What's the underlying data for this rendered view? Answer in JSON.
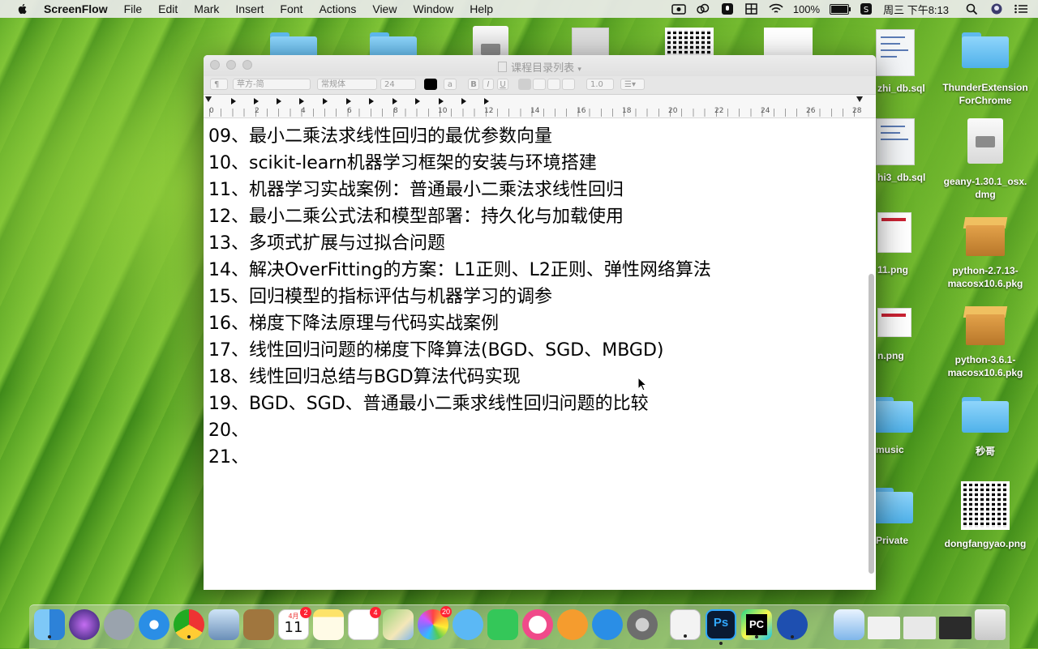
{
  "menubar": {
    "app_name": "ScreenFlow",
    "items": [
      "File",
      "Edit",
      "Mark",
      "Insert",
      "Font",
      "Actions",
      "View",
      "Window",
      "Help"
    ],
    "battery": "100%",
    "clock": "周三 下午8:13"
  },
  "desktop": {
    "icons": [
      {
        "label": "zhi_db.sql"
      },
      {
        "label": "ThunderExtension ForChrome"
      },
      {
        "label": "hi3_db.sql"
      },
      {
        "label": "geany-1.30.1_osx. dmg"
      },
      {
        "label": "11.png"
      },
      {
        "label": "python-2.7.13- macosx10.6.pkg"
      },
      {
        "label": "n.png"
      },
      {
        "label": "python-3.6.1- macosx10.6.pkg"
      },
      {
        "label": "music"
      },
      {
        "label": "秒哥"
      },
      {
        "label": "Private"
      },
      {
        "label": "dongfangyao.png"
      }
    ]
  },
  "window": {
    "title": "课程目录列表",
    "toolbar": {
      "paragraph": "¶",
      "font_family": "苹方-简",
      "font_style": "常规体",
      "font_size": "24",
      "bold": "B",
      "italic": "I",
      "underline": "U",
      "line_spacing": "1.0"
    },
    "ruler_numbers": [
      "0",
      "2",
      "4",
      "6",
      "8",
      "10",
      "12",
      "14",
      "16",
      "18",
      "20",
      "22",
      "24",
      "26",
      "28"
    ],
    "lines": [
      "09、最小二乘法求线性回归的最优参数向量",
      "10、scikit-learn机器学习框架的安装与环境搭建",
      "11、机器学习实战案例：普通最小二乘法求线性回归",
      "12、最小二乘公式法和模型部署：持久化与加载使用",
      "13、多项式扩展与过拟合问题",
      "14、解决OverFitting的方案：L1正则、L2正则、弹性网络算法",
      "15、回归模型的指标评估与机器学习的调参",
      "16、梯度下降法原理与代码实战案例",
      "17、线性回归问题的梯度下降算法(BGD、SGD、MBGD)",
      "18、线性回归总结与BGD算法代码实现",
      "19、BGD、SGD、普通最小二乘求线性回归问题的比较",
      "20、",
      "21、"
    ]
  },
  "dock": {
    "calendar_month": "4月",
    "calendar_day": "11",
    "calendar_badge": "2",
    "reminders_badge": "4",
    "photos_badge": "20",
    "ps_label": "Ps",
    "pc_label": "PC"
  }
}
